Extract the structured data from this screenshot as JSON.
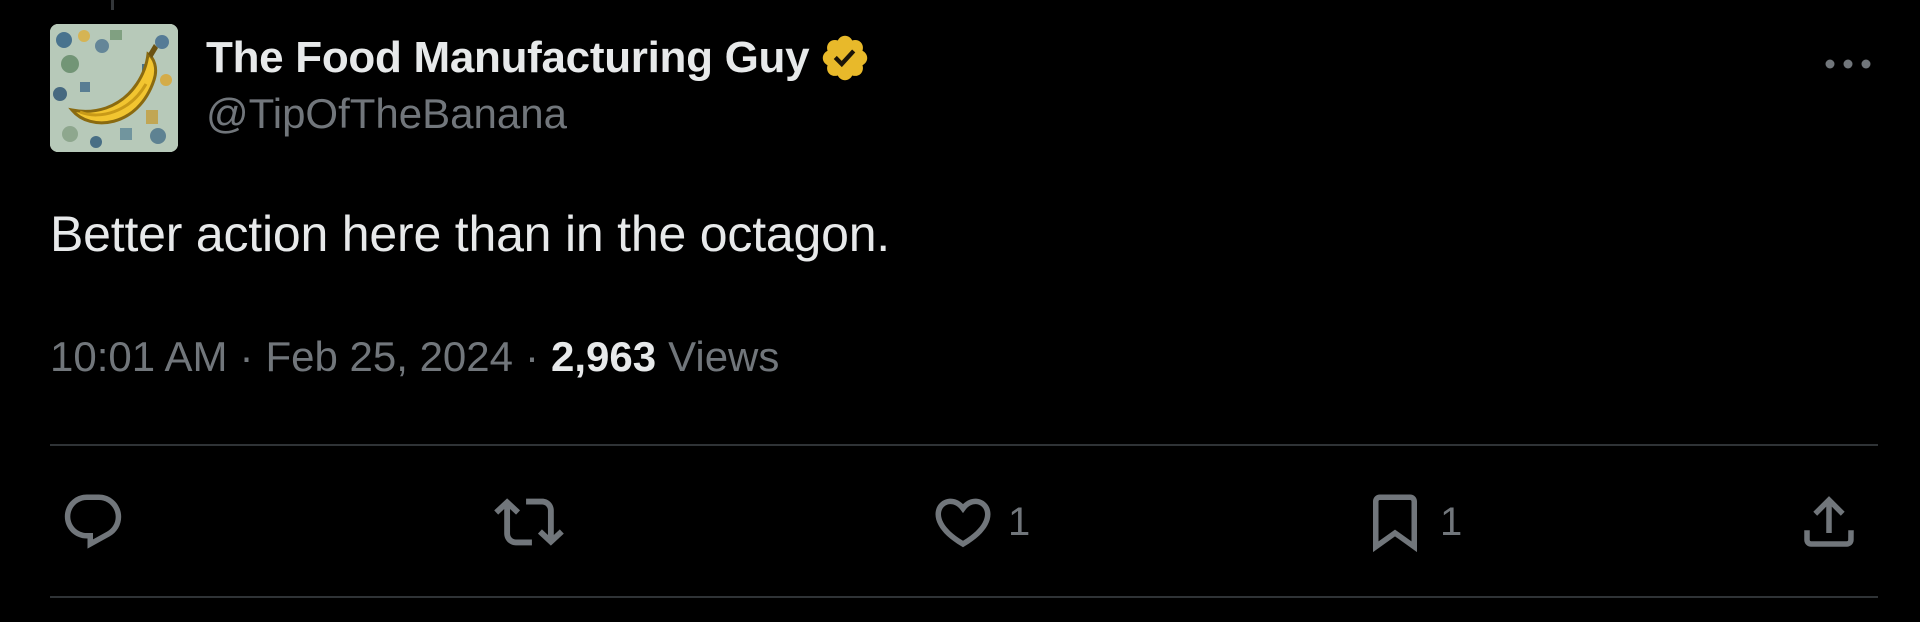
{
  "tweet": {
    "author": {
      "display_name": "The Food Manufacturing Guy",
      "handle": "@TipOfTheBanana",
      "avatar": "banana-avatar",
      "verified_badge": "gold-verified-badge-icon",
      "badge_color": "#e8b92a"
    },
    "text": "Better action here than in the octagon.",
    "meta": {
      "time": "10:01 AM",
      "separator": "·",
      "date": "Feb 25, 2024",
      "views_count": "2,963",
      "views_label": "Views"
    },
    "more_icon": "more-horizontal-icon",
    "actions": {
      "reply": {
        "icon": "reply-icon",
        "count": ""
      },
      "repost": {
        "icon": "repost-icon",
        "count": ""
      },
      "like": {
        "icon": "heart-icon",
        "count": "1"
      },
      "bookmark": {
        "icon": "bookmark-icon",
        "count": "1"
      },
      "share": {
        "icon": "share-icon",
        "count": ""
      }
    }
  },
  "colors": {
    "background": "#000000",
    "primary_text": "#e7e9ea",
    "secondary_text": "#71767b",
    "divider": "#2f3336"
  }
}
